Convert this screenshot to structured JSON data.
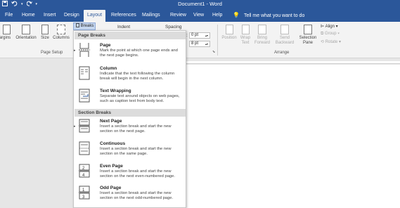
{
  "window": {
    "title": "Document1 - Word",
    "save_icon": "save-icon",
    "undo_icon": "undo-icon",
    "redo_icon": "redo-icon",
    "customize_icon": "customize-quick-access-icon"
  },
  "tabs": [
    "File",
    "Home",
    "Insert",
    "Design",
    "Layout",
    "References",
    "Mailings",
    "Review",
    "View",
    "Help"
  ],
  "active_tab": "Layout",
  "tell_me": "Tell me what you want to do",
  "ribbon": {
    "page_setup": {
      "margins": "argins",
      "orientation": "Orientation",
      "size": "Size",
      "columns": "Columns",
      "group_label": "Page Setup",
      "breaks": "Breaks"
    },
    "indent_label": "Indent",
    "spacing_label": "Spacing",
    "spacing_before": "0 pt",
    "spacing_after": "8 pt",
    "arrange": {
      "position": "Position",
      "wrap_text_1": "Wrap",
      "wrap_text_2": "Text",
      "bring_forward_1": "Bring",
      "bring_forward_2": "Forward",
      "send_backward_1": "Send",
      "send_backward_2": "Backward",
      "selection_pane_1": "Selection",
      "selection_pane_2": "Pane",
      "align": "Align",
      "group": "Group",
      "rotate": "Rotate",
      "group_label": "Arrange"
    }
  },
  "breaks_menu": {
    "page_breaks_header": "Page Breaks",
    "section_breaks_header": "Section Breaks",
    "items": [
      {
        "title": "Page",
        "desc": "Mark the point at which one page ends and the next page begins.",
        "icon": "page-break-icon"
      },
      {
        "title": "Column",
        "desc": "Indicate that the text following the column break will begin in the next column.",
        "icon": "column-break-icon"
      },
      {
        "title": "Text Wrapping",
        "desc": "Separate text around objects on web pages, such as caption text from body text.",
        "icon": "text-wrapping-break-icon"
      },
      {
        "title": "Next Page",
        "desc": "Insert a section break and start the new section on the next page.",
        "icon": "next-page-break-icon"
      },
      {
        "title": "Continuous",
        "desc": "Insert a section break and start the new section on the same page.",
        "icon": "continuous-break-icon"
      },
      {
        "title": "Even Page",
        "desc": "Insert a section break and start the new section on the next even-numbered page.",
        "icon": "even-page-break-icon"
      },
      {
        "title": "Odd Page",
        "desc": "Insert a section break and start the new section on the next odd-numbered page.",
        "icon": "odd-page-break-icon"
      }
    ]
  },
  "colors": {
    "title_bar": "#2b579a",
    "ribbon_bg": "#f3f3f3",
    "menu_header_bg": "#dcdcdc"
  }
}
